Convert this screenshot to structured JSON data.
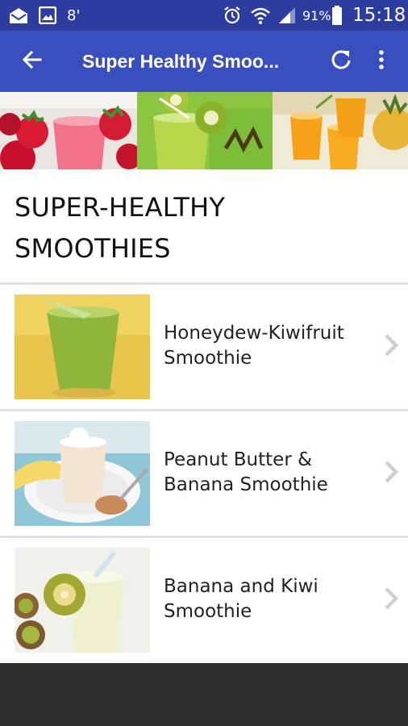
{
  "status_bar": {
    "signal_label": "8'",
    "battery_text": "91%",
    "time": "15:18",
    "icons": [
      "mail-icon",
      "image-icon",
      "alarm-icon",
      "wifi-icon",
      "cell-signal-icon",
      "battery-icon"
    ]
  },
  "toolbar": {
    "title": "Super Healthy Smoo...",
    "back_icon": "arrow-back-icon",
    "refresh_icon": "refresh-icon",
    "more_icon": "more-vert-icon",
    "color": "#3a4fbf"
  },
  "hero": {
    "panels": [
      "strawberry-smoothie-image",
      "kiwi-smoothie-image",
      "pineapple-juice-image"
    ]
  },
  "page": {
    "heading_line1": "SUPER-HEALTHY",
    "heading_line2": "SMOOTHIES"
  },
  "recipes": [
    {
      "line1": "Honeydew-Kiwifruit",
      "line2": "Smoothie",
      "thumb": "honeydew-kiwifruit-smoothie-image"
    },
    {
      "line1": "Peanut Butter &",
      "line2": "Banana Smoothie",
      "thumb": "peanut-butter-banana-smoothie-image"
    },
    {
      "line1": "Banana and Kiwi",
      "line2": "Smoothie",
      "thumb": "banana-kiwi-smoothie-image"
    }
  ]
}
